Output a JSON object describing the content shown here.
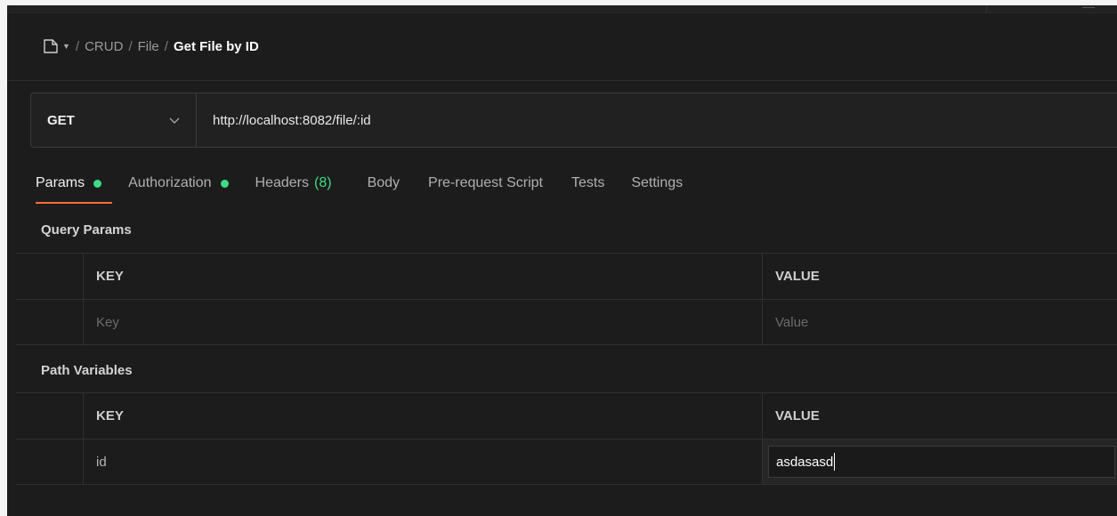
{
  "breadcrumb": {
    "items": [
      "CRUD",
      "File"
    ],
    "current": "Get File by ID",
    "separator": "/"
  },
  "request": {
    "method": "GET",
    "url": "http://localhost:8082/file/:id"
  },
  "tabs": [
    {
      "label": "Params",
      "dot": true,
      "active": true
    },
    {
      "label": "Authorization",
      "dot": true
    },
    {
      "label": "Headers",
      "count": "(8)"
    },
    {
      "label": "Body"
    },
    {
      "label": "Pre-request Script"
    },
    {
      "label": "Tests"
    },
    {
      "label": "Settings"
    }
  ],
  "query_params": {
    "title": "Query Params",
    "key_header": "KEY",
    "value_header": "VALUE",
    "key_placeholder": "Key",
    "value_placeholder": "Value"
  },
  "path_variables": {
    "title": "Path Variables",
    "key_header": "KEY",
    "value_header": "VALUE",
    "rows": [
      {
        "key": "id",
        "value": "asdasasd"
      }
    ]
  },
  "colors": {
    "accent": "#ff6c37",
    "status_green": "#3ddc84",
    "background": "#1c1c1c"
  },
  "icons": [
    "collection-icon",
    "caret-down-icon",
    "chevron-down-icon"
  ]
}
